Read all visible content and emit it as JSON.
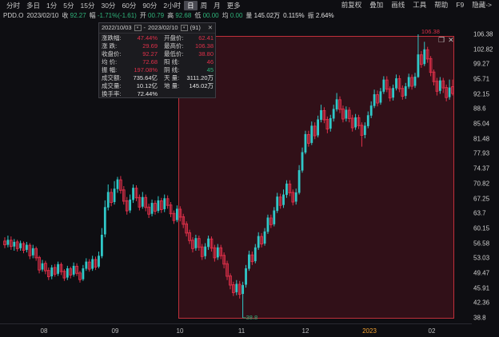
{
  "toolbar": {
    "periods": [
      "分时",
      "多日",
      "1分",
      "5分",
      "15分",
      "30分",
      "60分",
      "90分",
      "2小时",
      "日",
      "周",
      "月",
      "更多"
    ],
    "active_period": "日",
    "right_items": [
      "前复权",
      "叠加",
      "画线",
      "工具",
      "帮助",
      "F9",
      "隐藏->"
    ]
  },
  "quote": {
    "symbol": "PDD.O",
    "date": "2023/02/10",
    "close_label": "收",
    "close": "92.27",
    "change_label": "幅",
    "change": "-1.71%(-1.61)",
    "open_label": "开",
    "open": "00.79",
    "high_label": "高",
    "high": "92.68",
    "low_label": "低",
    "low": "00.00",
    "avg_label": "均",
    "avg": "0.00",
    "volume_label": "量",
    "volume": "145.02万",
    "turnover_value": "0.115%",
    "amplitude_label": "振",
    "amplitude": "2.64%"
  },
  "tooltip": {
    "range_start": "2022/10/03",
    "range_end": "2023/02/10",
    "days": "(91)",
    "rows_left": [
      {
        "label": "涨跌幅:",
        "value": "47.44%",
        "color": "red"
      },
      {
        "label": "涨    跌:",
        "value": "29.69",
        "color": "red"
      },
      {
        "label": "收盘价:",
        "value": "92.27",
        "color": "red"
      },
      {
        "label": "均    价:",
        "value": "72.68",
        "color": "red"
      },
      {
        "label": "振    幅:",
        "value": "197.08%",
        "color": "red"
      },
      {
        "label": "成交额:",
        "value": "735.64亿",
        "color": "white"
      },
      {
        "label": "成交量:",
        "value": "10.12亿",
        "color": "white"
      },
      {
        "label": "换手率:",
        "value": "72.44%",
        "color": "white"
      }
    ],
    "rows_right": [
      {
        "label": "开盘价:",
        "value": "62.41",
        "color": "red"
      },
      {
        "label": "最高价:",
        "value": "106.38",
        "color": "red"
      },
      {
        "label": "最低价:",
        "value": "38.80",
        "color": "red"
      },
      {
        "label": "阳    线:",
        "value": "46",
        "color": "red"
      },
      {
        "label": "阴    线:",
        "value": "45",
        "color": "grn"
      },
      {
        "label": "天    量:",
        "value": "3111.20万",
        "color": "white"
      },
      {
        "label": "地    量:",
        "value": "145.02万",
        "color": "white"
      }
    ]
  },
  "chart_data": {
    "type": "candlestick",
    "y_ticks": [
      "106.38",
      "102.82",
      "99.27",
      "95.71",
      "92.15",
      "88.6",
      "85.04",
      "81.48",
      "77.93",
      "74.37",
      "70.82",
      "67.25",
      "63.7",
      "60.15",
      "56.58",
      "53.03",
      "49.47",
      "45.91",
      "42.36",
      "38.8"
    ],
    "x_ticks": [
      "08",
      "09",
      "10",
      "11",
      "12",
      "2023",
      "02"
    ],
    "highlighted_x_tick": "2023",
    "ylim": [
      38.8,
      106.38
    ],
    "annotation_high": "106.38",
    "annotation_low": "38.8",
    "colors": {
      "up": "#30c8c8",
      "down": "#e0304a",
      "selection": "#c0303a"
    },
    "candles": [
      [
        57.1,
        56.2,
        58.0,
        55.4
      ],
      [
        56.2,
        57.4,
        58.4,
        55.6
      ],
      [
        57.3,
        55.8,
        58.2,
        55.0
      ],
      [
        55.8,
        56.9,
        57.6,
        54.8
      ],
      [
        56.9,
        55.3,
        57.4,
        54.6
      ],
      [
        55.4,
        56.6,
        57.2,
        54.8
      ],
      [
        56.5,
        54.9,
        57.0,
        54.2
      ],
      [
        55.0,
        56.2,
        56.9,
        54.4
      ],
      [
        56.1,
        53.6,
        56.6,
        52.8
      ],
      [
        53.7,
        55.4,
        56.2,
        53.0
      ],
      [
        55.3,
        53.1,
        55.8,
        52.4
      ],
      [
        53.2,
        50.2,
        53.6,
        49.4
      ],
      [
        50.3,
        51.8,
        52.6,
        49.8
      ],
      [
        51.8,
        50.0,
        52.4,
        49.2
      ],
      [
        50.1,
        48.6,
        50.8,
        47.8
      ],
      [
        48.7,
        50.8,
        51.4,
        48.0
      ],
      [
        50.8,
        49.2,
        51.6,
        48.6
      ],
      [
        49.3,
        51.6,
        52.2,
        48.8
      ],
      [
        51.5,
        49.8,
        52.0,
        49.0
      ],
      [
        49.9,
        48.3,
        50.4,
        47.6
      ],
      [
        48.4,
        50.6,
        51.2,
        47.8
      ],
      [
        50.5,
        49.0,
        51.0,
        48.2
      ],
      [
        49.1,
        51.2,
        52.0,
        48.6
      ],
      [
        51.1,
        49.4,
        51.8,
        48.8
      ],
      [
        49.5,
        47.9,
        50.0,
        47.2
      ],
      [
        48.0,
        50.6,
        51.4,
        47.6
      ],
      [
        50.5,
        52.2,
        53.0,
        50.0
      ],
      [
        52.1,
        50.4,
        52.8,
        49.8
      ],
      [
        50.5,
        52.8,
        53.6,
        50.0
      ],
      [
        52.7,
        50.9,
        53.4,
        50.2
      ],
      [
        51.0,
        53.6,
        54.6,
        50.6
      ],
      [
        53.5,
        58.6,
        60.2,
        53.0
      ],
      [
        58.7,
        65.2,
        66.8,
        58.0
      ],
      [
        65.1,
        68.8,
        70.6,
        64.4
      ],
      [
        68.7,
        66.3,
        69.6,
        65.4
      ],
      [
        66.4,
        69.6,
        71.4,
        65.8
      ],
      [
        69.5,
        71.8,
        72.4,
        68.6
      ],
      [
        71.7,
        69.2,
        72.6,
        68.4
      ],
      [
        69.3,
        66.6,
        70.2,
        65.8
      ],
      [
        66.7,
        64.3,
        67.6,
        63.4
      ],
      [
        64.4,
        67.0,
        68.2,
        63.8
      ],
      [
        66.9,
        69.8,
        70.6,
        66.2
      ],
      [
        69.7,
        67.4,
        70.4,
        66.6
      ],
      [
        67.5,
        65.2,
        68.2,
        64.4
      ],
      [
        65.3,
        67.6,
        68.8,
        64.8
      ],
      [
        67.5,
        65.1,
        68.2,
        64.2
      ],
      [
        65.2,
        63.5,
        66.0,
        62.6
      ],
      [
        63.6,
        66.2,
        67.0,
        63.0
      ],
      [
        66.1,
        64.2,
        66.8,
        63.4
      ],
      [
        64.3,
        66.8,
        67.8,
        63.8
      ],
      [
        66.7,
        64.6,
        67.4,
        63.8
      ],
      [
        64.7,
        67.3,
        68.2,
        64.0
      ],
      [
        67.2,
        65.6,
        68.0,
        64.8
      ],
      [
        65.7,
        63.6,
        66.4,
        62.8
      ],
      [
        63.7,
        62.0,
        64.4,
        61.2
      ],
      [
        62.1,
        64.8,
        65.6,
        61.6
      ],
      [
        64.7,
        62.8,
        65.4,
        61.8
      ],
      [
        62.9,
        61.1,
        63.6,
        60.2
      ],
      [
        61.2,
        59.0,
        61.8,
        58.2
      ],
      [
        59.1,
        57.2,
        59.8,
        56.4
      ],
      [
        57.3,
        55.3,
        58.0,
        54.4
      ],
      [
        55.4,
        57.8,
        58.6,
        54.8
      ],
      [
        57.7,
        55.6,
        58.4,
        54.8
      ],
      [
        55.7,
        53.4,
        56.4,
        52.6
      ],
      [
        53.5,
        55.8,
        56.6,
        52.8
      ],
      [
        55.7,
        57.7,
        58.4,
        55.0
      ],
      [
        57.6,
        55.4,
        58.2,
        54.6
      ],
      [
        55.5,
        53.1,
        56.2,
        52.2
      ],
      [
        53.2,
        55.6,
        56.4,
        52.6
      ],
      [
        55.5,
        53.6,
        56.2,
        52.8
      ],
      [
        53.7,
        51.6,
        54.4,
        50.6
      ],
      [
        51.7,
        48.7,
        52.4,
        47.8
      ],
      [
        48.8,
        46.6,
        49.4,
        45.6
      ],
      [
        46.7,
        44.8,
        47.4,
        44.0
      ],
      [
        44.9,
        46.9,
        47.8,
        44.2
      ],
      [
        46.8,
        44.4,
        47.6,
        43.4
      ],
      [
        44.5,
        46.6,
        47.4,
        38.8
      ],
      [
        46.7,
        50.6,
        51.4,
        46.0
      ],
      [
        50.5,
        53.9,
        54.8,
        50.0
      ],
      [
        53.8,
        52.2,
        54.6,
        51.4
      ],
      [
        52.3,
        55.6,
        56.4,
        51.8
      ],
      [
        55.5,
        58.3,
        59.2,
        55.0
      ],
      [
        58.2,
        56.4,
        59.0,
        55.6
      ],
      [
        56.5,
        59.4,
        60.2,
        56.0
      ],
      [
        59.3,
        62.7,
        63.4,
        58.8
      ],
      [
        62.6,
        61.0,
        63.4,
        60.2
      ],
      [
        61.1,
        64.4,
        65.2,
        60.6
      ],
      [
        64.3,
        67.7,
        68.6,
        63.8
      ],
      [
        67.6,
        65.6,
        68.4,
        64.8
      ],
      [
        65.7,
        68.2,
        69.4,
        65.0
      ],
      [
        68.1,
        70.8,
        71.6,
        67.4
      ],
      [
        70.7,
        68.6,
        71.6,
        67.8
      ],
      [
        68.7,
        66.4,
        69.4,
        65.6
      ],
      [
        66.5,
        68.7,
        69.6,
        65.8
      ],
      [
        68.6,
        74.0,
        75.2,
        68.2
      ],
      [
        73.9,
        78.3,
        79.4,
        73.4
      ],
      [
        78.2,
        82.6,
        83.4,
        77.8
      ],
      [
        82.5,
        80.4,
        83.4,
        79.6
      ],
      [
        80.5,
        84.6,
        85.6,
        80.0
      ],
      [
        84.5,
        82.2,
        85.4,
        81.4
      ],
      [
        82.3,
        86.1,
        87.0,
        81.8
      ],
      [
        86.0,
        88.3,
        89.6,
        85.4
      ],
      [
        88.2,
        86.0,
        89.0,
        85.2
      ],
      [
        86.1,
        83.8,
        86.8,
        82.8
      ],
      [
        83.9,
        86.4,
        87.2,
        83.2
      ],
      [
        86.3,
        88.6,
        89.6,
        85.6
      ],
      [
        88.5,
        90.9,
        92.4,
        88.0
      ],
      [
        90.8,
        88.5,
        91.6,
        87.6
      ],
      [
        88.6,
        86.2,
        89.4,
        85.4
      ],
      [
        86.3,
        88.4,
        89.2,
        85.6
      ],
      [
        88.3,
        86.3,
        89.0,
        85.4
      ],
      [
        86.4,
        84.1,
        87.2,
        83.2
      ],
      [
        84.2,
        86.6,
        87.4,
        83.6
      ],
      [
        86.5,
        84.6,
        87.2,
        83.8
      ],
      [
        84.7,
        82.3,
        85.4,
        79.6
      ],
      [
        82.4,
        84.6,
        85.4,
        81.6
      ],
      [
        84.5,
        87.1,
        88.0,
        84.0
      ],
      [
        87.0,
        89.4,
        90.4,
        86.4
      ],
      [
        89.3,
        92.1,
        93.2,
        88.8
      ],
      [
        92.0,
        90.0,
        93.0,
        89.2
      ],
      [
        90.1,
        92.8,
        93.6,
        89.6
      ],
      [
        92.7,
        95.6,
        96.4,
        92.2
      ],
      [
        95.5,
        93.3,
        96.4,
        92.6
      ],
      [
        93.4,
        91.2,
        94.0,
        90.4
      ],
      [
        91.3,
        93.6,
        94.4,
        90.6
      ],
      [
        93.5,
        95.9,
        96.8,
        93.0
      ],
      [
        95.8,
        93.4,
        96.6,
        92.6
      ],
      [
        93.5,
        91.6,
        94.2,
        90.8
      ],
      [
        91.7,
        94.0,
        94.8,
        91.0
      ],
      [
        93.9,
        96.2,
        97.0,
        93.4
      ],
      [
        96.1,
        94.0,
        96.8,
        93.2
      ],
      [
        94.1,
        96.3,
        97.2,
        93.6
      ],
      [
        96.2,
        101.6,
        106.38,
        96.0
      ],
      [
        101.5,
        99.2,
        102.4,
        98.4
      ],
      [
        99.3,
        102.8,
        104.6,
        98.8
      ],
      [
        102.7,
        100.5,
        103.4,
        99.6
      ],
      [
        100.6,
        97.3,
        101.2,
        96.4
      ],
      [
        97.4,
        95.1,
        98.0,
        94.2
      ],
      [
        95.2,
        92.8,
        96.0,
        91.8
      ],
      [
        92.9,
        95.4,
        96.2,
        92.2
      ],
      [
        95.3,
        93.6,
        96.0,
        92.4
      ],
      [
        93.7,
        91.3,
        94.4,
        90.4
      ],
      [
        91.4,
        93.7,
        95.6,
        90.8
      ],
      [
        93.9,
        92.27,
        95.6,
        91.8
      ]
    ]
  }
}
